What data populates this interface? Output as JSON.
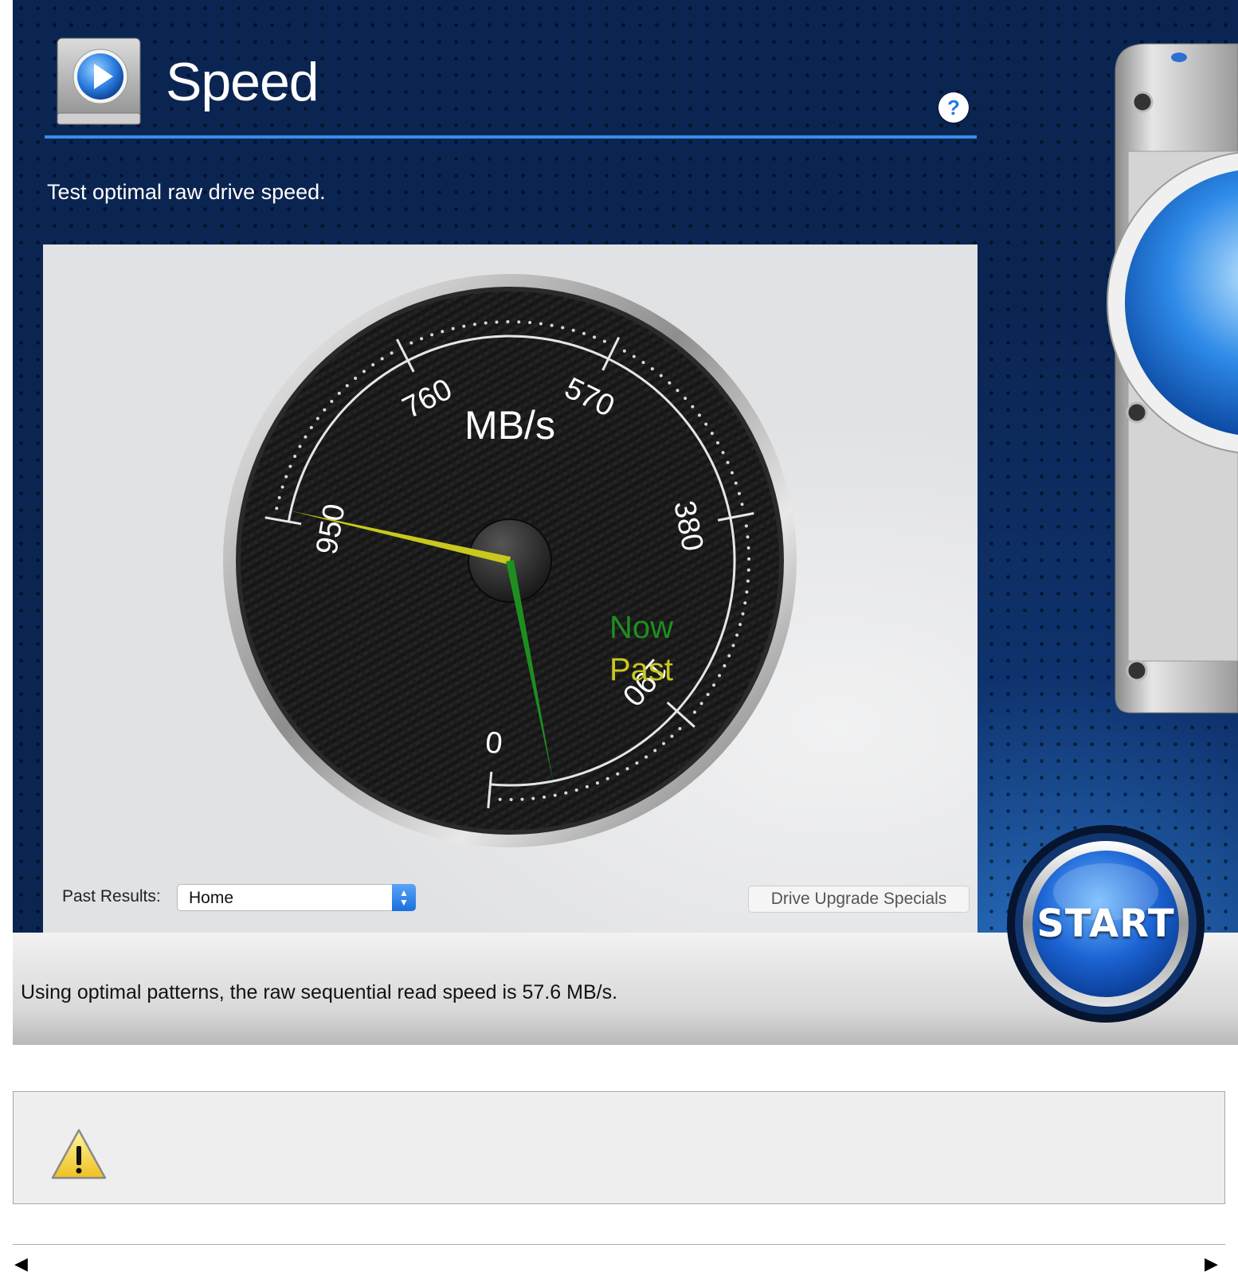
{
  "app": {
    "title": "Speed",
    "subtitle": "Test optimal raw drive speed.",
    "help_label": "?"
  },
  "gauge": {
    "unit": "MB/s",
    "ticks": [
      "0",
      "190",
      "380",
      "570",
      "760",
      "950"
    ],
    "scale_max": 950,
    "now_label": "Now",
    "past_label": "Past",
    "now_value": 57.6,
    "past_value": 940,
    "now_color": "#1e8f1e",
    "past_color": "#c8c81e",
    "arc_color": "#e6e6e6"
  },
  "controls": {
    "past_results_label": "Past Results:",
    "past_results_value": "Home",
    "upgrade_button": "Drive Upgrade Specials",
    "start_button": "START"
  },
  "status": {
    "message": "Using optimal patterns, the raw sequential read speed is 57.6 MB/s."
  },
  "icons": {
    "drive": "drive-play-icon",
    "help": "help-icon",
    "warning": "warning-icon",
    "scroll_left": "scroll-left-icon",
    "scroll_right": "scroll-right-icon"
  },
  "scroll": {
    "left": "◀",
    "right": "▶"
  },
  "colors": {
    "background": "#0b2552",
    "accent": "#3a8de6"
  }
}
